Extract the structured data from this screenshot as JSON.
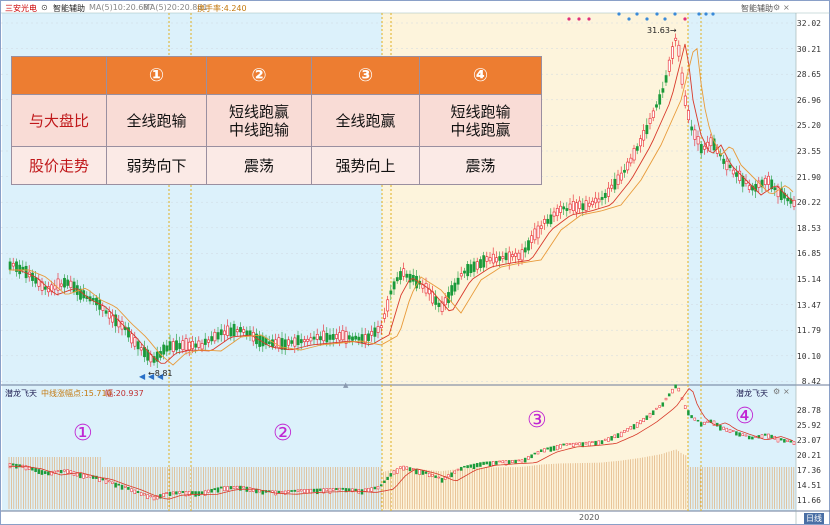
{
  "header": {
    "stock_name": "三安光电",
    "assist_label": "智能辅助",
    "ma1": "MA(5)10:20.687",
    "ma2": "MA(5)20:20.861",
    "extra": "换手率:4.240",
    "right_label": "智能辅助"
  },
  "table": {
    "headers": [
      "",
      "①",
      "②",
      "③",
      "④"
    ],
    "rows": [
      {
        "label": "与大盘比",
        "cells": [
          "全线跑输",
          "短线跑赢\n中线跑输",
          "全线跑赢",
          "短线跑输\n中线跑赢"
        ]
      },
      {
        "label": "股价走势",
        "cells": [
          "弱势向下",
          "震荡",
          "强势向上",
          "震荡"
        ]
      }
    ]
  },
  "price_axis": [
    "32.02",
    "30.21",
    "28.65",
    "26.96",
    "25.20",
    "23.55",
    "21.90",
    "20.22",
    "18.53",
    "16.85",
    "15.14",
    "13.47",
    "11.79",
    "10.10",
    "8.42"
  ],
  "price_annotations": {
    "high": "31.63→",
    "low": "←8.81"
  },
  "lower_panel": {
    "title": "潜龙飞天",
    "ind1": "中线涨幅点:15.710",
    "ind2": "幅:20.937",
    "right_title": "潜龙飞天",
    "axis": [
      "28.78",
      "25.92",
      "23.07",
      "20.21",
      "17.36",
      "14.51",
      "11.66"
    ]
  },
  "zone_labels": [
    "①",
    "②",
    "③",
    "④"
  ],
  "x_label": "2020",
  "period_label": "日线",
  "colors": {
    "zone_blue": "#dcf1fb",
    "zone_yellow": "#fdf4dc",
    "up": "#e8202a",
    "down": "#1a9a3a",
    "ma_red": "#d83a2a",
    "ma_orange": "#e89a3a",
    "table_header": "#ed7d31",
    "divider": "#e0b020",
    "label_purple": "#c026d3"
  }
}
